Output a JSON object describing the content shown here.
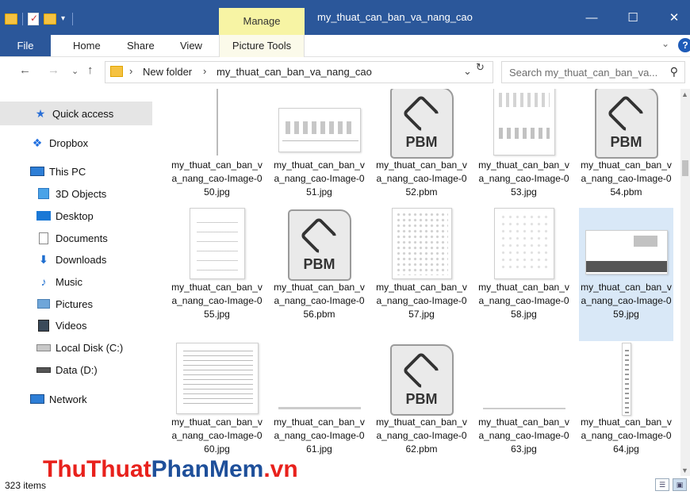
{
  "titlebar": {
    "manage_tab": "Manage",
    "window_title": "my_thuat_can_ban_va_nang_cao",
    "minimize": "—",
    "maximize": "☐",
    "close": "✕"
  },
  "ribbon": {
    "file": "File",
    "home": "Home",
    "share": "Share",
    "view": "View",
    "picture_tools": "Picture Tools",
    "help": "?"
  },
  "address": {
    "crumbs": [
      "New folder",
      "my_thuat_can_ban_va_nang_cao"
    ],
    "search_placeholder": "Search my_thuat_can_ban_va..."
  },
  "nav": {
    "items": [
      {
        "label": "Quick access",
        "icon": "star-icon"
      },
      {
        "label": "Dropbox",
        "icon": "dropbox-icon"
      },
      {
        "label": "This PC",
        "icon": "computer-icon"
      },
      {
        "label": "3D Objects",
        "icon": "cube-icon"
      },
      {
        "label": "Desktop",
        "icon": "desktop-icon"
      },
      {
        "label": "Documents",
        "icon": "documents-icon"
      },
      {
        "label": "Downloads",
        "icon": "downloads-icon"
      },
      {
        "label": "Music",
        "icon": "music-icon"
      },
      {
        "label": "Pictures",
        "icon": "pictures-icon"
      },
      {
        "label": "Videos",
        "icon": "videos-icon"
      },
      {
        "label": "Local Disk (C:)",
        "icon": "local-disk-icon"
      },
      {
        "label": "Data (D:)",
        "icon": "drive-icon"
      },
      {
        "label": "Network",
        "icon": "network-icon"
      }
    ]
  },
  "files": [
    {
      "name": "my_thuat_can_ban_va_nang_cao-Image-050.jpg",
      "kind": "jpg"
    },
    {
      "name": "my_thuat_can_ban_va_nang_cao-Image-051.jpg",
      "kind": "jpg"
    },
    {
      "name": "my_thuat_can_ban_va_nang_cao-Image-052.pbm",
      "kind": "pbm"
    },
    {
      "name": "my_thuat_can_ban_va_nang_cao-Image-053.jpg",
      "kind": "jpg"
    },
    {
      "name": "my_thuat_can_ban_va_nang_cao-Image-054.pbm",
      "kind": "pbm"
    },
    {
      "name": "my_thuat_can_ban_va_nang_cao-Image-055.jpg",
      "kind": "jpg"
    },
    {
      "name": "my_thuat_can_ban_va_nang_cao-Image-056.pbm",
      "kind": "pbm"
    },
    {
      "name": "my_thuat_can_ban_va_nang_cao-Image-057.jpg",
      "kind": "jpg"
    },
    {
      "name": "my_thuat_can_ban_va_nang_cao-Image-058.jpg",
      "kind": "jpg"
    },
    {
      "name": "my_thuat_can_ban_va_nang_cao-Image-059.jpg",
      "kind": "jpg",
      "selected": true
    },
    {
      "name": "my_thuat_can_ban_va_nang_cao-Image-060.jpg",
      "kind": "jpg"
    },
    {
      "name": "my_thuat_can_ban_va_nang_cao-Image-061.jpg",
      "kind": "jpg"
    },
    {
      "name": "my_thuat_can_ban_va_nang_cao-Image-062.pbm",
      "kind": "pbm"
    },
    {
      "name": "my_thuat_can_ban_va_nang_cao-Image-063.jpg",
      "kind": "jpg"
    },
    {
      "name": "my_thuat_can_ban_va_nang_cao-Image-064.jpg",
      "kind": "jpg"
    }
  ],
  "pbm_label": "PBM",
  "status": {
    "count": "323 items"
  },
  "watermark": {
    "part1": "ThuThuat",
    "part2": "PhanMem",
    "part3": ".vn"
  },
  "colors": {
    "titlebar": "#2b579a",
    "manage_tab": "#f7f4a4",
    "selection": "#d9e8f7",
    "watermark_red": "#e8211c",
    "watermark_blue": "#1e4f9a"
  }
}
